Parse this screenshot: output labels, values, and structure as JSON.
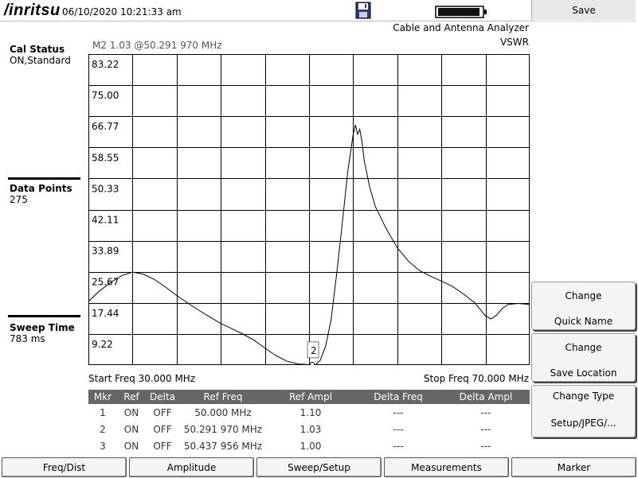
{
  "header": {
    "brand": "/inritsu",
    "datetime": "06/10/2020 10:21:33 am",
    "disk_icon": "floppy-disk-icon",
    "battery_icon": "battery-icon"
  },
  "titles": {
    "app": "Cable and Antenna Analyzer",
    "measurement": "VSWR",
    "marker_readout": "M2 1.03 @50.291 970 MHz"
  },
  "left_panel": {
    "cal_status": {
      "label": "Cal Status",
      "value": "ON,Standard"
    },
    "data_points": {
      "label": "Data Points",
      "value": "275"
    },
    "sweep_time": {
      "label": "Sweep Time",
      "value": "783 ms"
    }
  },
  "chart_data": {
    "type": "line",
    "ylabels": [
      "83.22",
      "75.00",
      "66.77",
      "58.55",
      "50.33",
      "42.11",
      "33.89",
      "25.67",
      "17.44",
      "9.22"
    ],
    "ylim": [
      1,
      83.22
    ],
    "xlim": [
      30,
      70
    ],
    "x_unit": "MHz",
    "grid": true,
    "marker": {
      "label": "2",
      "x": 50.29197,
      "y": 1.03
    },
    "series": [
      {
        "points": [
          [
            30.0,
            17.8
          ],
          [
            31.0,
            20.6
          ],
          [
            32.0,
            22.8
          ],
          [
            33.0,
            24.6
          ],
          [
            34.0,
            25.6
          ],
          [
            35.0,
            25.0
          ],
          [
            36.0,
            23.6
          ],
          [
            37.0,
            21.6
          ],
          [
            38.0,
            19.4
          ],
          [
            39.0,
            17.4
          ],
          [
            40.0,
            15.5
          ],
          [
            41.0,
            13.7
          ],
          [
            42.0,
            12.0
          ],
          [
            43.0,
            10.6
          ],
          [
            44.0,
            9.2
          ],
          [
            45.0,
            7.6
          ],
          [
            46.0,
            5.5
          ],
          [
            47.0,
            3.5
          ],
          [
            48.0,
            2.0
          ],
          [
            49.0,
            1.3
          ],
          [
            50.0,
            1.1
          ],
          [
            50.3,
            1.03
          ],
          [
            50.6,
            1.15
          ],
          [
            51.0,
            2.2
          ],
          [
            51.5,
            6.0
          ],
          [
            52.0,
            13.0
          ],
          [
            52.5,
            25.0
          ],
          [
            53.0,
            38.0
          ],
          [
            53.5,
            52.0
          ],
          [
            54.0,
            62.0
          ],
          [
            54.2,
            64.5
          ],
          [
            54.4,
            62.0
          ],
          [
            54.6,
            63.3
          ],
          [
            54.8,
            60.0
          ],
          [
            55.0,
            55.0
          ],
          [
            55.5,
            48.0
          ],
          [
            56.0,
            43.0
          ],
          [
            57.0,
            37.0
          ],
          [
            58.0,
            32.0
          ],
          [
            59.0,
            28.5
          ],
          [
            60.0,
            26.0
          ],
          [
            61.0,
            24.5
          ],
          [
            62.0,
            23.2
          ],
          [
            63.0,
            21.8
          ],
          [
            64.0,
            19.8
          ],
          [
            65.0,
            17.5
          ],
          [
            66.0,
            14.0
          ],
          [
            66.5,
            13.2
          ],
          [
            67.0,
            14.2
          ],
          [
            67.5,
            15.9
          ],
          [
            68.0,
            17.0
          ],
          [
            69.0,
            17.3
          ],
          [
            70.0,
            17.0
          ]
        ]
      }
    ]
  },
  "freq": {
    "start": "Start Freq 30.000 MHz",
    "stop": "Stop Freq 70.000 MHz"
  },
  "marker_table": {
    "headers": [
      "Mkr",
      "Ref",
      "Delta",
      "Ref Freq",
      "Ref Ampl",
      "Delta Freq",
      "Delta Ampl"
    ],
    "rows": [
      [
        "1",
        "ON",
        "OFF",
        "50.000 MHz",
        "1.10",
        "---",
        "---"
      ],
      [
        "2",
        "ON",
        "OFF",
        "50.291 970 MHz",
        "1.03",
        "---",
        "---"
      ],
      [
        "3",
        "ON",
        "OFF",
        "50.437 956 MHz",
        "1.00",
        "---",
        "---"
      ]
    ]
  },
  "softkeys": {
    "save": "Save",
    "change_quick_name": {
      "line1": "Change",
      "line2": "Quick Name"
    },
    "change_save_location": {
      "line1": "Change",
      "line2": "Save Location"
    },
    "change_type": {
      "line1": "Change Type",
      "line2": "Setup/JPEG/..."
    }
  },
  "bottom_menu": [
    "Freq/Dist",
    "Amplitude",
    "Sweep/Setup",
    "Measurements",
    "Marker"
  ],
  "colors": {
    "trace": "#000000",
    "grid": "#000000",
    "table_header_bg": "#666666"
  }
}
